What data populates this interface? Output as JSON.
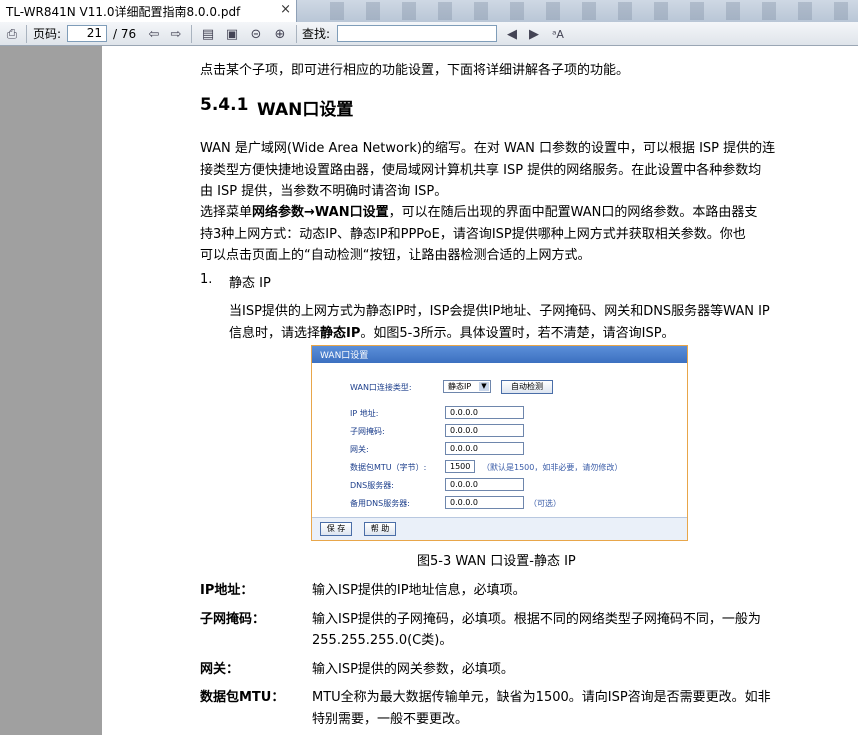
{
  "tab": {
    "title": "TL-WR841N  V11.0详细配置指南8.0.0.pdf",
    "close": "×"
  },
  "toolbar": {
    "page_label": "页码:",
    "page_current": "21",
    "page_total": "/ 76",
    "find_label": "查找:",
    "find_value": ""
  },
  "doc": {
    "intro": "点击某个子项，即可进行相应的功能设置，下面将详细讲解各子项的功能。",
    "section_number": "5.4.1",
    "section_title": "WAN口设置",
    "para1_line1": "WAN 是广域网(Wide Area Network)的缩写。在对 WAN 口参数的设置中，可以根据 ISP 提供的连",
    "para1_line2": "接类型方便快捷地设置路由器，使局域网计算机共享 ISP 提供的网络服务。在此设置中各种参数均",
    "para1_line3": "由 ISP 提供，当参数不明确时请咨询 ISP。",
    "para2_line1_a": "选择菜单",
    "para2_line1_b": "网络参数→WAN口设置",
    "para2_line1_c": "，可以在随后出现的界面中配置WAN口的网络参数。本路由器支",
    "para2_line2": "持3种上网方式：动态IP、静态IP和PPPoE，请咨询ISP提供哪种上网方式并获取相关参数。你也",
    "para2_line3": "可以点击页面上的“自动检测“按钮，让路由器检测合适的上网方式。",
    "item1_num": "1.",
    "item1_title": "静态 IP",
    "item1_para_line1": "当ISP提供的上网方式为静态IP时，ISP会提供IP地址、子网掩码、网关和DNS服务器等WAN IP",
    "item1_para_line2_a": "信息时，请选择",
    "item1_para_line2_b": "静态IP",
    "item1_para_line2_c": "。如图5-3所示。具体设置时，若不清楚，请咨询ISP。",
    "caption": "图5-3 WAN 口设置-静态 IP",
    "defs": [
      {
        "term": "IP地址：",
        "desc1": "输入ISP提供的IP地址信息，必填项。",
        "desc2": ""
      },
      {
        "term": "子网掩码：",
        "desc1": "输入ISP提供的子网掩码，必填项。根据不同的网络类型子网掩码不同，一般为",
        "desc2": "255.255.255.0(C类)。"
      },
      {
        "term": "网关：",
        "desc1": "输入ISP提供的网关参数，必填项。",
        "desc2": ""
      },
      {
        "term": "数据包MTU：",
        "desc1": "MTU全称为最大数据传输单元，缺省为1500。请向ISP咨询是否需要更改。如非",
        "desc2": "特别需要，一般不要更改。"
      }
    ]
  },
  "figure": {
    "title": "WAN口设置",
    "conn_type_label": "WAN口连接类型:",
    "conn_type_value": "静态IP",
    "auto_detect": "自动检测",
    "ip_label": "IP 地址:",
    "ip_value": "0.0.0.0",
    "mask_label": "子网掩码:",
    "mask_value": "0.0.0.0",
    "gateway_label": "网关:",
    "gateway_value": "0.0.0.0",
    "mtu_label": "数据包MTU（字节）:",
    "mtu_value": "1500",
    "mtu_note": "（默认是1500，如非必要，请勿修改）",
    "dns_label": "DNS服务器:",
    "dns_value": "0.0.0.0",
    "dns2_label": "备用DNS服务器:",
    "dns2_value": "0.0.0.0",
    "dns2_note": "（可选）",
    "save": "保 存",
    "help": "帮 助"
  }
}
